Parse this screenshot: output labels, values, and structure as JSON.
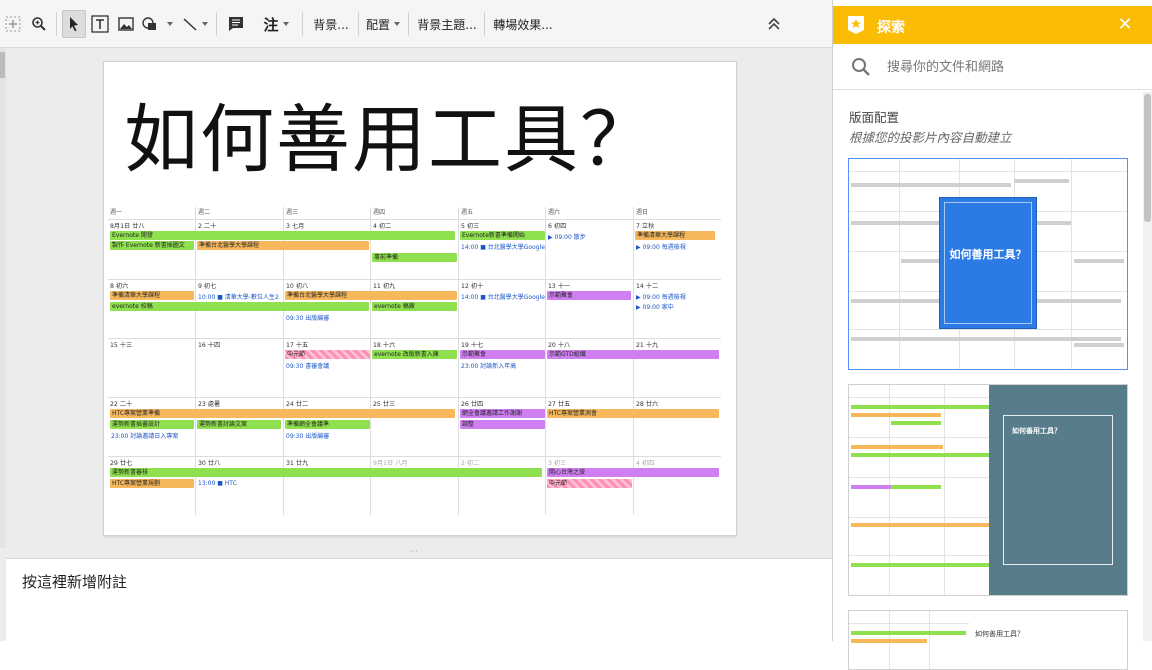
{
  "toolbar": {
    "background_label": "背景...",
    "layout_label": "配置",
    "theme_label": "背景主題...",
    "transition_label": "轉場效果...",
    "comment_label": "注"
  },
  "slide": {
    "title": "如何善用工具？"
  },
  "calendar": {
    "weekdays": [
      "週一",
      "週二",
      "週三",
      "週四",
      "週五",
      "週六",
      "週日"
    ],
    "weeks": [
      {
        "days": [
          "8月1日 廿八",
          "2 二十",
          "3 七月",
          "4 初二",
          "5 初三",
          "6 初四",
          "7 立秋"
        ],
        "events": [
          {
            "text": "Evernote 開發",
            "color": "green"
          },
          {
            "text": "製作 Evernote 新書插圖文",
            "color": "green"
          },
          {
            "text": "準備台北醫學大學課程",
            "color": "orange"
          },
          {
            "text": "準備清華大學課程",
            "color": "orange"
          },
          {
            "text": "Evernote新書準備開始",
            "color": "green"
          },
          {
            "text": "事前準備",
            "color": "green"
          },
          {
            "text": "14:00 ■ 台北醫學大學Google",
            "color": "link"
          },
          {
            "text": "▶ 09:00 散步",
            "color": "link"
          },
          {
            "text": "▶ 09:00 每週檢視",
            "color": "link"
          }
        ]
      },
      {
        "days": [
          "8 初六",
          "9 初七",
          "10 初八",
          "11 初九",
          "12 初十",
          "13 十一",
          "14 十二"
        ],
        "events": [
          {
            "text": "準備清華大學課程",
            "color": "orange"
          },
          {
            "text": "10:00 ■ 清華大學-數位人生2",
            "color": "link"
          },
          {
            "text": "準備台北醫學大學課程",
            "color": "orange"
          },
          {
            "text": "evernote 校稿",
            "color": "green"
          },
          {
            "text": "evernote 稿廠",
            "color": "green"
          },
          {
            "text": "14:00 ■ 台北醫學大學Google",
            "color": "link"
          },
          {
            "text": "示範聚會",
            "color": "purple"
          },
          {
            "text": "09:30 出版編審",
            "color": "link"
          },
          {
            "text": "▶ 09:00 每週檢視",
            "color": "link"
          },
          {
            "text": "▶ 09:00 家中",
            "color": "link"
          }
        ]
      },
      {
        "days": [
          "15 十三",
          "16 十四",
          "17 十五",
          "18 十六",
          "19 十七",
          "20 十八",
          "21 十九"
        ],
        "events": [
          {
            "text": "中元節",
            "color": "pink"
          },
          {
            "text": "evernote 改版新書入庫",
            "color": "green"
          },
          {
            "text": "示範聚會",
            "color": "purple"
          },
          {
            "text": "示範GTD組織",
            "color": "purple"
          },
          {
            "text": "09:30 書審會議",
            "color": "link"
          },
          {
            "text": "23:00 討論新入年高",
            "color": "link"
          }
        ]
      },
      {
        "days": [
          "22 二十",
          "23 處暑",
          "24 廿二",
          "25 廿三",
          "26 廿四",
          "27 廿五",
          "28 廿六"
        ],
        "events": [
          {
            "text": "HTC專案營業準備",
            "color": "orange"
          },
          {
            "text": "運勢新書插畫設計",
            "color": "green"
          },
          {
            "text": "運勢新書討論文案",
            "color": "green"
          },
          {
            "text": "準備網全會議準",
            "color": "green"
          },
          {
            "text": "網全會議邀請工作謝謝",
            "color": "purple"
          },
          {
            "text": "HTC專案營業測會",
            "color": "orange"
          },
          {
            "text": "調整",
            "color": "purple"
          },
          {
            "text": "23:00 討論邀請日入專案",
            "color": "link"
          },
          {
            "text": "09:30 出版編審",
            "color": "link"
          }
        ]
      },
      {
        "days": [
          "29 廿七",
          "30 廿八",
          "31 廿九",
          "9月1日 八月",
          "2 初二",
          "3 初三",
          "4 初四"
        ],
        "events": [
          {
            "text": "運勢新書審核",
            "color": "green"
          },
          {
            "text": "開心台灣之旅",
            "color": "purple"
          },
          {
            "text": "HTC專案營業規劃",
            "color": "orange"
          },
          {
            "text": "13:00 ■ HTC",
            "color": "link"
          },
          {
            "text": "中元節",
            "color": "pink"
          }
        ]
      }
    ]
  },
  "notes": {
    "placeholder": "按這裡新增附註"
  },
  "explore": {
    "title": "探索",
    "search_placeholder": "搜尋你的文件和網路",
    "layout_title": "版面配置",
    "layout_subtitle": "根據您的投影片內容自動建立",
    "thumbs": [
      {
        "text": "如何善用工具？"
      },
      {
        "text": "如何善用工具？"
      },
      {
        "text": "如何善用工具？"
      }
    ]
  },
  "colors": {
    "explore_header": "#fbbc05",
    "selected_border": "#4d90fe",
    "event_green": "#8fe04f",
    "event_orange": "#f7b85c",
    "event_purple": "#cf7ff2"
  }
}
